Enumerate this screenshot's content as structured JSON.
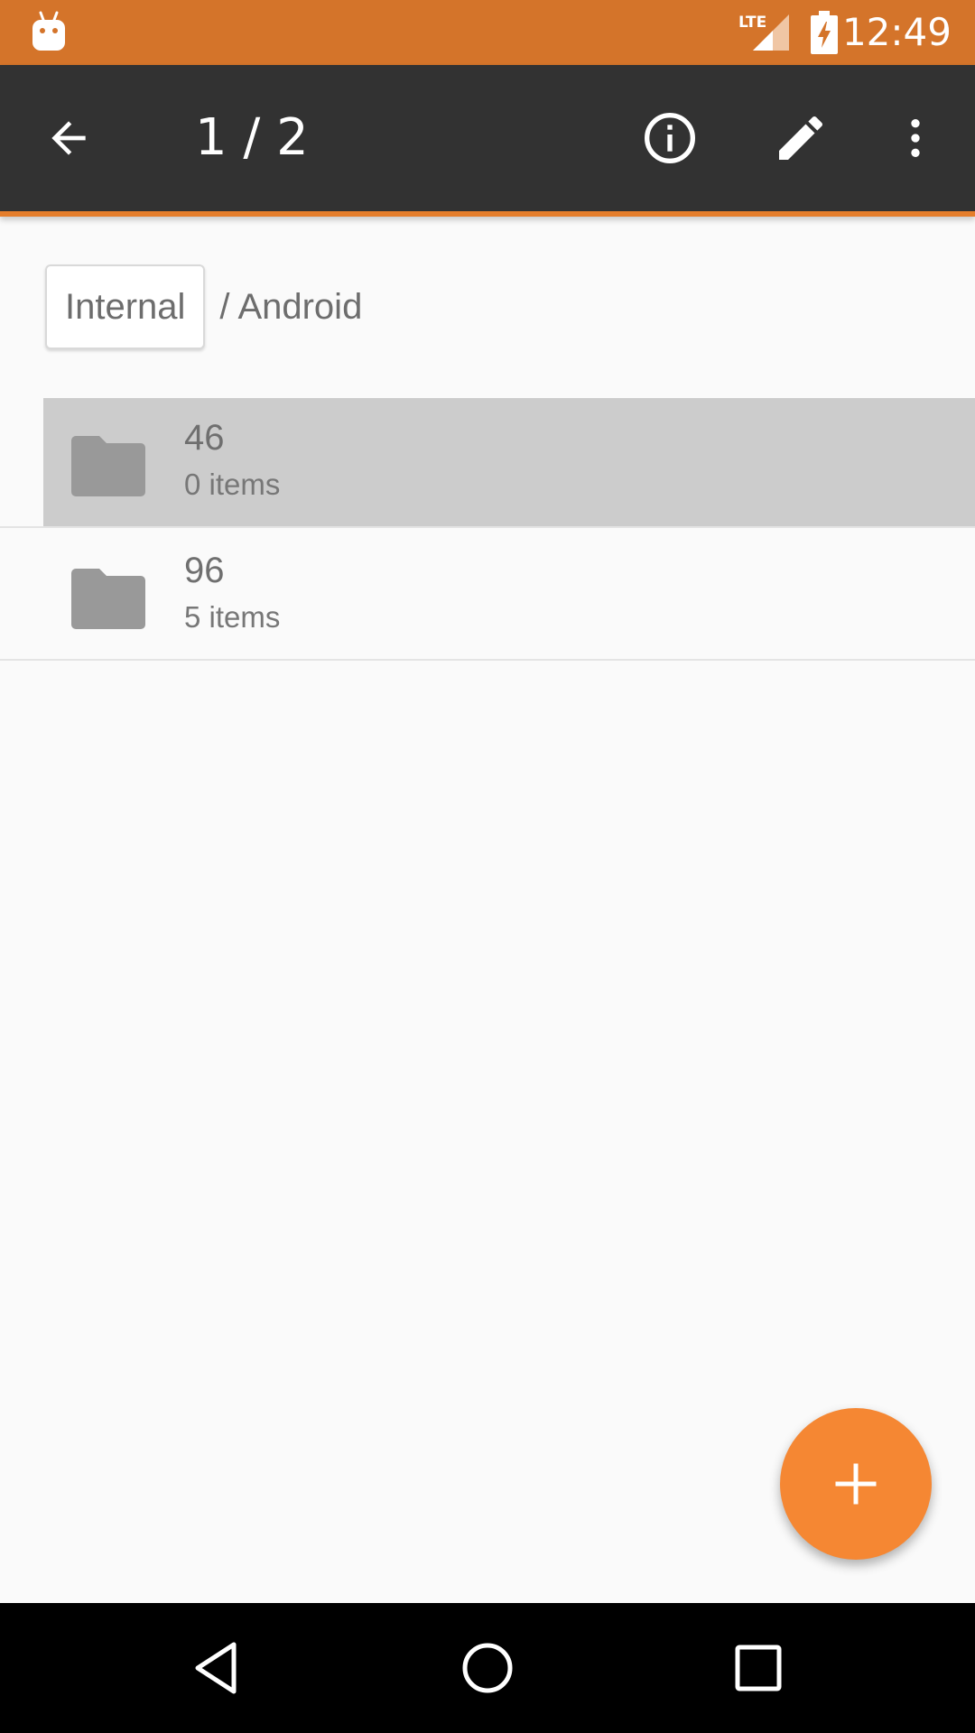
{
  "status_bar": {
    "time": "12:49",
    "network": "LTE",
    "icons": [
      "android-notification-icon",
      "lte-signal-icon",
      "battery-charging-icon"
    ]
  },
  "toolbar": {
    "title": "1 / 2",
    "icons": [
      "back-arrow-icon",
      "info-icon",
      "pencil-icon",
      "more-vert-icon"
    ]
  },
  "breadcrumb": {
    "root": "Internal",
    "path": "/ Android"
  },
  "folders": [
    {
      "name": "46",
      "meta": "0 items",
      "selected": true
    },
    {
      "name": "96",
      "meta": "5 items",
      "selected": false
    }
  ],
  "fab": {
    "icon": "plus-icon"
  },
  "nav_bar": {
    "icons": [
      "nav-back-icon",
      "nav-home-icon",
      "nav-recent-icon"
    ]
  },
  "colors": {
    "status_bar": "#d4742a",
    "toolbar": "#323232",
    "accent": "#f58733",
    "selected_row": "#cccccc"
  }
}
